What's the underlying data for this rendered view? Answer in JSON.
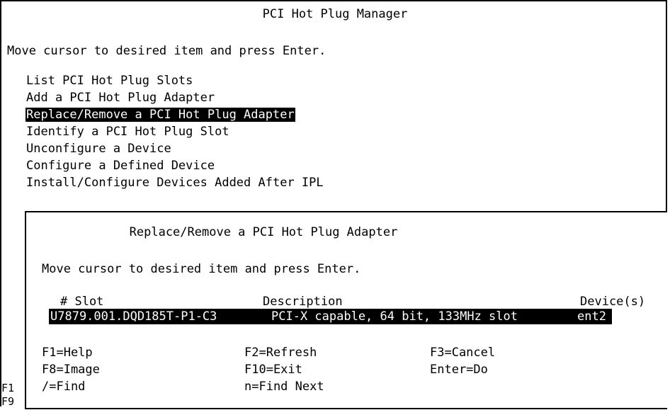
{
  "main": {
    "title": "PCI Hot Plug Manager",
    "instruction": "Move cursor to desired item and press Enter.",
    "menu_items": [
      {
        "label": "List PCI Hot Plug Slots",
        "selected": false
      },
      {
        "label": "Add a PCI Hot Plug Adapter",
        "selected": false
      },
      {
        "label": "Replace/Remove a PCI Hot Plug Adapter",
        "selected": true
      },
      {
        "label": "Identify a PCI Hot Plug Slot",
        "selected": false
      },
      {
        "label": "Unconfigure a Device",
        "selected": false
      },
      {
        "label": "Configure a Defined Device",
        "selected": false
      },
      {
        "label": "Install/Configure Devices Added After IPL",
        "selected": false
      }
    ]
  },
  "dialog": {
    "title": "Replace/Remove a PCI Hot Plug Adapter",
    "instruction": "Move cursor to desired item and press Enter.",
    "columns": {
      "slot": "# Slot",
      "description": "Description",
      "devices": "Device(s)"
    },
    "rows": [
      {
        "slot": "U7879.001.DQD185T-P1-C3",
        "description": "PCI-X capable, 64 bit, 133MHz slot",
        "devices": "ent2"
      }
    ],
    "function_keys": {
      "f1": "F1=Help",
      "f2": "F2=Refresh",
      "f3": "F3=Cancel",
      "f8": "F8=Image",
      "f10": "F10=Exit",
      "enter": "Enter=Do",
      "find": "/=Find",
      "find_next": "n=Find Next"
    }
  },
  "partial_labels": {
    "f1": "F1",
    "f9": "F9"
  }
}
